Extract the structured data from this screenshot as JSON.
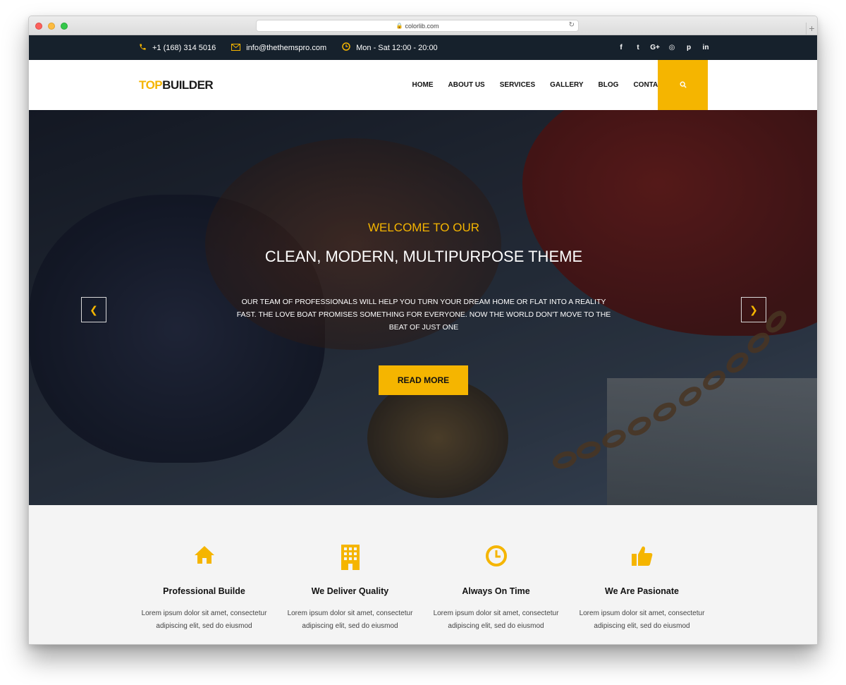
{
  "browser": {
    "url": "colorlib.com"
  },
  "topbar": {
    "phone": "+1 (168) 314 5016",
    "email": "info@thethemspro.com",
    "hours": "Mon - Sat 12:00 - 20:00",
    "social": [
      {
        "icon": "facebook-icon",
        "glyph": "f"
      },
      {
        "icon": "twitter-icon",
        "glyph": "t"
      },
      {
        "icon": "google-plus-icon",
        "glyph": "G+"
      },
      {
        "icon": "instagram-icon",
        "glyph": "◎"
      },
      {
        "icon": "pinterest-icon",
        "glyph": "p"
      },
      {
        "icon": "linkedin-icon",
        "glyph": "in"
      }
    ]
  },
  "header": {
    "logo_top": "TOP",
    "logo_builder": "BUILDER",
    "nav": [
      "HOME",
      "ABOUT US",
      "SERVICES",
      "GALLERY",
      "BLOG",
      "CONTACT"
    ]
  },
  "hero": {
    "welcome": "WELCOME TO OUR",
    "title": "CLEAN, MODERN, MULTIPURPOSE THEME",
    "description": "OUR TEAM OF PROFESSIONALS WILL HELP YOU TURN YOUR DREAM HOME OR FLAT INTO A REALITY FAST. THE LOVE BOAT PROMISES SOMETHING FOR EVERYONE. NOW THE WORLD DON'T MOVE TO THE BEAT OF JUST ONE",
    "button": "READ MORE"
  },
  "features": [
    {
      "icon": "home-icon",
      "title": "Professional Builde",
      "text": "Lorem ipsum dolor sit amet, consectetur adipiscing elit, sed do eiusmod"
    },
    {
      "icon": "building-icon",
      "title": "We Deliver Quality",
      "text": "Lorem ipsum dolor sit amet, consectetur adipiscing elit, sed do eiusmod"
    },
    {
      "icon": "clock-icon",
      "title": "Always On Time",
      "text": "Lorem ipsum dolor sit amet, consectetur adipiscing elit, sed do eiusmod"
    },
    {
      "icon": "thumbs-up-icon",
      "title": "We Are Pasionate",
      "text": "Lorem ipsum dolor sit amet, consectetur adipiscing elit, sed do eiusmod"
    }
  ],
  "colors": {
    "accent": "#f5b500",
    "topbar": "#16212c",
    "features_bg": "#f4f4f4"
  }
}
